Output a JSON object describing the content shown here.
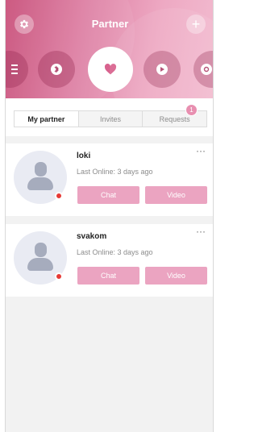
{
  "header": {
    "title": "Partner",
    "settings_icon": "gear-icon",
    "add_icon": "plus-icon",
    "add_label": "+",
    "gradient": [
      "#c9507a",
      "#f2bcd0"
    ],
    "modes": [
      {
        "icon": "menu-icon",
        "active": false
      },
      {
        "icon": "bluetooth-icon",
        "active": false
      },
      {
        "icon": "heart-icon",
        "active": true
      },
      {
        "icon": "play-icon",
        "active": false
      },
      {
        "icon": "camera-icon",
        "active": false
      }
    ]
  },
  "tabs": [
    {
      "label": "My partner",
      "active": true
    },
    {
      "label": "Invites",
      "active": false
    },
    {
      "label": "Requests",
      "active": false,
      "badge": "1"
    }
  ],
  "partners": [
    {
      "name": "loki",
      "last_online": "Last Online: 3 days ago",
      "chat_label": "Chat",
      "video_label": "Video",
      "more_label": "···"
    },
    {
      "name": "svakom",
      "last_online": "Last Online: 3 days ago",
      "chat_label": "Chat",
      "video_label": "Video",
      "more_label": "···"
    }
  ],
  "colors": {
    "accent": "#eba4c1",
    "status_offline": "#e63a36",
    "badge": "#e88fb0"
  }
}
